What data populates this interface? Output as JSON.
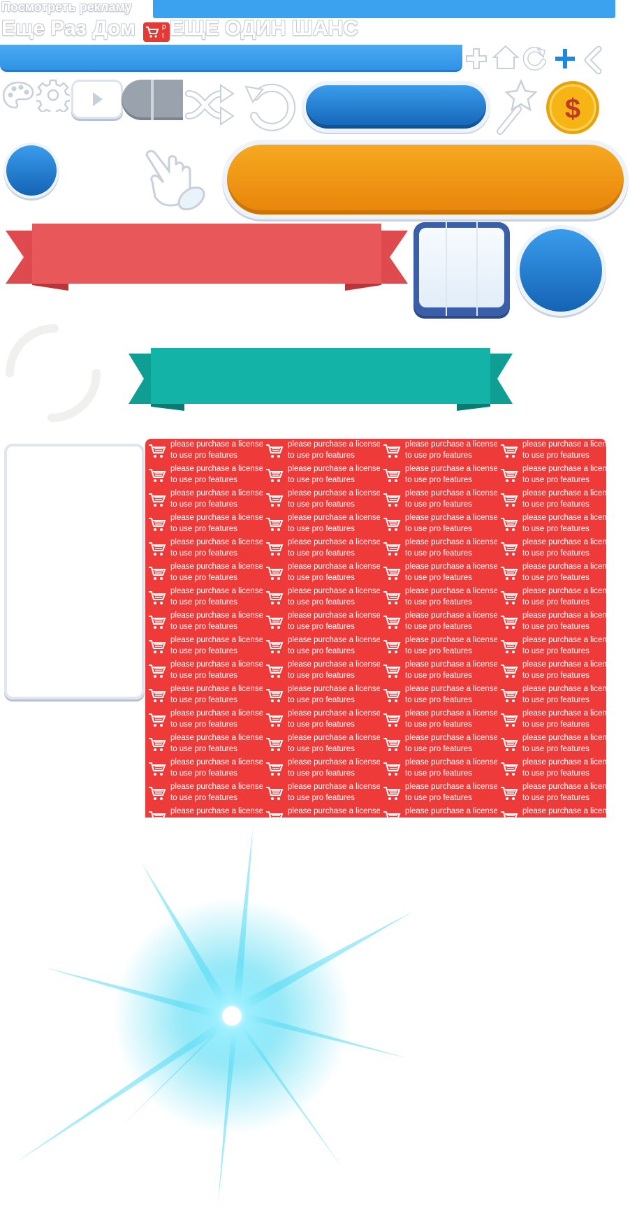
{
  "header": {
    "ad_link": "Посмотреть рекламу",
    "title_left": "Еще Раз Дом",
    "title_right": "ЕЩЕ ОДИН ШАНС",
    "pro_badge_line1": "p",
    "pro_badge_line2": "t"
  },
  "watermark": {
    "line1": "please purchase a license",
    "line2": "to use pro features"
  },
  "coin": {
    "symbol": "$"
  },
  "colors": {
    "blue": "#2f93e6",
    "orange": "#f39a17",
    "red_ribbon": "#e8575a",
    "teal_ribbon": "#14b3a8",
    "watermark_bg": "#ef3a3a",
    "gold": "#f7b515"
  },
  "icons": [
    "plus-icon",
    "home-icon",
    "refresh-icon",
    "plus-blue-icon",
    "back-icon",
    "palette-icon",
    "gear-icon",
    "play-icon",
    "toggle-icon",
    "shuffle-icon",
    "undo-icon",
    "magic-wand-icon",
    "coin-icon",
    "pointer-hand-icon",
    "cart-icon",
    "spinner-icon",
    "light-burst-icon"
  ]
}
